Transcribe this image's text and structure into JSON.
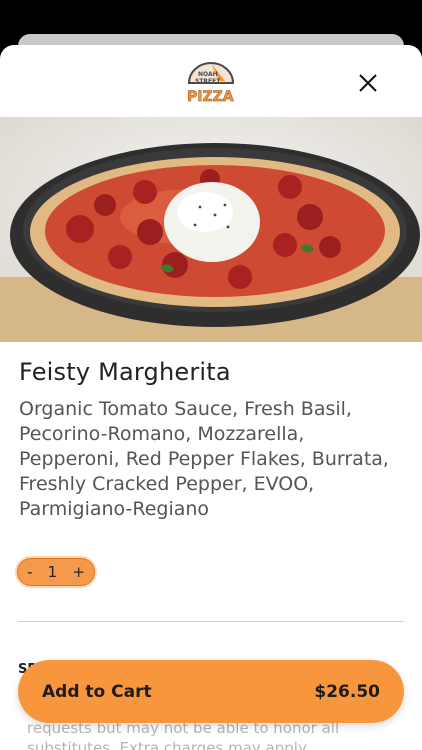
{
  "header": {
    "logo_line1": "NOAH",
    "logo_line2": "STREET",
    "logo_word": "PIZZA",
    "close_icon": "close-icon"
  },
  "item": {
    "name": "Feisty Margherita",
    "description": "Organic Tomato Sauce, Fresh Basil, Pecorino-Romano, Mozzarella, Pepperoni, Red Pepper Flakes, Burrata, Freshly Cracked Pepper, EVOO, Parmigiano-Regiano"
  },
  "quantity": {
    "minus_label": "-",
    "value": "1",
    "plus_label": "+"
  },
  "special": {
    "label": "SP",
    "note": "requests but may not be able to honor all substitutes. Extra charges may apply."
  },
  "cart": {
    "label": "Add to Cart",
    "price": "$26.50"
  },
  "colors": {
    "accent": "#f7963d",
    "text_dark": "#222222",
    "text_muted": "#555555"
  }
}
